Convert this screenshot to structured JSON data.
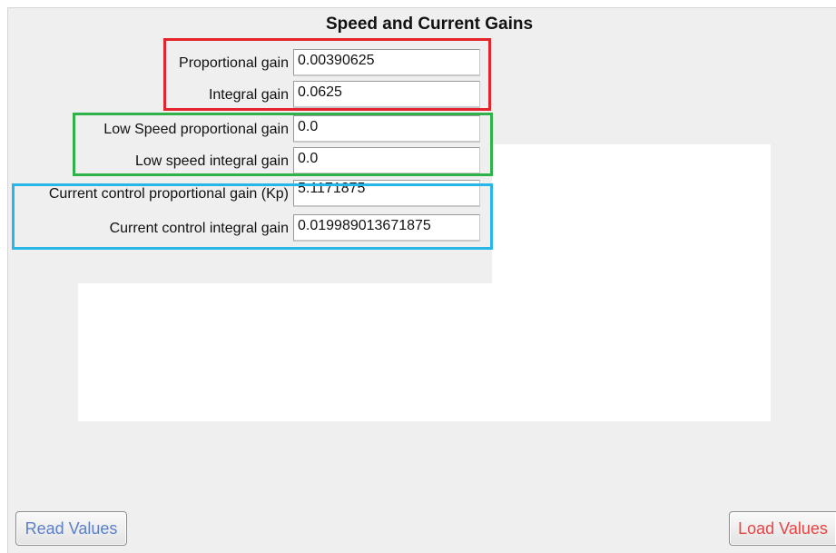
{
  "header": {
    "title": "Speed and Current Gains"
  },
  "speed_gains": {
    "proportional_label": "Proportional gain",
    "proportional_value": "0.00390625",
    "integral_label": "Integral gain",
    "integral_value": "0.0625"
  },
  "low_speed_gains": {
    "proportional_label": "Low Speed proportional gain",
    "proportional_value": "0.0",
    "integral_label": "Low speed integral gain",
    "integral_value": "0.0"
  },
  "current_gains": {
    "proportional_label": "Current control proportional gain (Kp)",
    "proportional_value": "5.1171875",
    "integral_label": "Current control integral gain",
    "integral_value": "0.019989013671875"
  },
  "buttons": {
    "read_label": "Read Values",
    "load_label": "Load Values"
  },
  "colors": {
    "speed_group": "#e3242b",
    "low_speed_group": "#2fb24a",
    "current_group": "#28b6e8",
    "read_button_text": "#5c7fc7",
    "load_button_text": "#e64545"
  }
}
